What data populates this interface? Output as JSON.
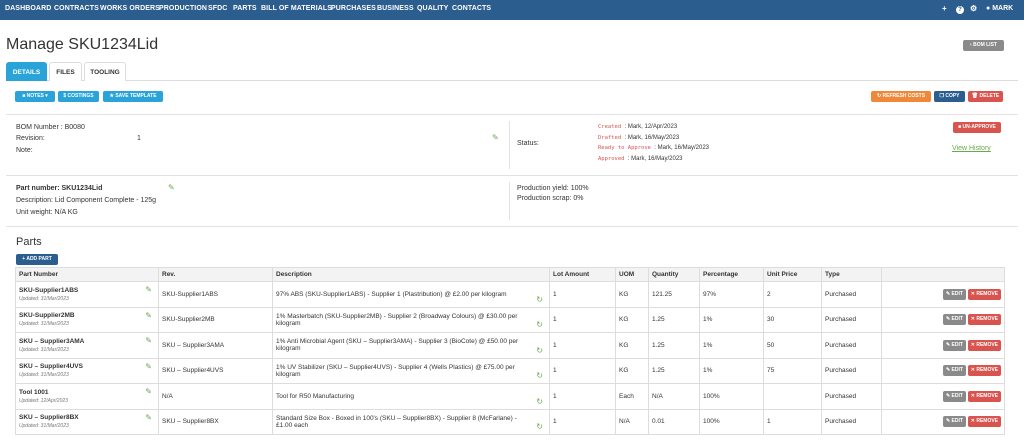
{
  "nav": {
    "items": [
      "DASHBOARD",
      "CONTRACTS",
      "WORKS ORDERS",
      "PRODUCTION",
      "SFDC",
      "PARTS",
      "BILL OF MATERIALS",
      "PURCHASES",
      "BUSINESS",
      "QUALITY",
      "CONTACTS"
    ],
    "plus": "+",
    "help": "?",
    "settings": "⚙",
    "user": "MARK"
  },
  "header": {
    "title": "Manage SKU1234Lid",
    "bom_list": "BOM LIST"
  },
  "tabs": [
    "DETAILS",
    "FILES",
    "TOOLING"
  ],
  "toolbar": {
    "notes": "NOTES",
    "costings": "COSTINGS",
    "save_template": "SAVE TEMPLATE",
    "refresh_costs": "REFRESH COSTS",
    "copy": "COPY",
    "delete": "DELETE"
  },
  "bom": {
    "number": "BOM Number : B0080",
    "revision_label": "Revision:",
    "revision_value": "1",
    "note_label": "Note:",
    "status_label": "Status:",
    "unapprove": "UN-APPROVE",
    "view_history": "View History",
    "history": [
      {
        "label": "Created",
        "value": ": Mark, 12/Apr/2023"
      },
      {
        "label": "Drafted",
        "value": ": Mark, 16/May/2023"
      },
      {
        "label": "Ready to Approve",
        "value": ": Mark, 16/May/2023"
      },
      {
        "label": "Approved",
        "value": ": Mark, 16/May/2023"
      }
    ]
  },
  "part": {
    "number": "Part number: SKU1234Lid",
    "description": "Description: Lid Component Complete - 125g",
    "unit_weight": "Unit weight: N/A KG",
    "yield": "Production yield: 100%",
    "scrap": "Production scrap: 0%"
  },
  "parts": {
    "title": "Parts",
    "add_part": "+ ADD PART",
    "columns": [
      "Part Number",
      "Rev.",
      "Description",
      "Lot Amount",
      "UOM",
      "Quantity",
      "Percentage",
      "Unit Price",
      "Type",
      ""
    ],
    "edit_label": "EDIT",
    "remove_label": "REMOVE",
    "rows": [
      {
        "name": "SKU-Supplier1ABS",
        "updated": "Updated: 31/Mar/2023",
        "rev": "SKU-Supplier1ABS",
        "description": "97% ABS (SKU-Supplier1ABS) - Supplier 1 (Plastribution) @ £2.00 per kilogram",
        "lot": "1",
        "uom": "KG",
        "quantity": "121.25",
        "percentage": "97%",
        "price": "2",
        "type": "Purchased"
      },
      {
        "name": "SKU-Supplier2MB",
        "updated": "Updated: 31/Mar/2023",
        "rev": "SKU-Supplier2MB",
        "description": "1% Masterbatch (SKU-Supplier2MB) - Supplier 2 (Broadway Colours) @ £30.00 per kilogram",
        "lot": "1",
        "uom": "KG",
        "quantity": "1.25",
        "percentage": "1%",
        "price": "30",
        "type": "Purchased"
      },
      {
        "name": "SKU – Supplier3AMA",
        "updated": "Updated: 31/Mar/2023",
        "rev": "SKU – Supplier3AMA",
        "description": "1% Anti Microbial Agent (SKU – Supplier3AMA) - Supplier 3 (BioCote) @ £50.00 per kilogram",
        "lot": "1",
        "uom": "KG",
        "quantity": "1.25",
        "percentage": "1%",
        "price": "50",
        "type": "Purchased"
      },
      {
        "name": "SKU – Supplier4UVS",
        "updated": "Updated: 31/Mar/2023",
        "rev": "SKU – Supplier4UVS",
        "description": "1% UV Stabilizer (SKU – Supplier4UVS) - Supplier 4 (Wells Plastics) @ £75.00 per kilogram",
        "lot": "1",
        "uom": "KG",
        "quantity": "1.25",
        "percentage": "1%",
        "price": "75",
        "type": "Purchased"
      },
      {
        "name": "Tool 1001",
        "updated": "Updated: 12/Apr/2023",
        "rev": "N/A",
        "description": "Tool for R50 Manufacturing",
        "lot": "1",
        "uom": "Each",
        "quantity": "N/A",
        "percentage": "100%",
        "price": "",
        "type": "Purchased"
      },
      {
        "name": "SKU – Supplier8BX",
        "updated": "Updated: 31/Mar/2023",
        "rev": "SKU – Supplier8BX",
        "description": "Standard Size Box - Boxed in 100's (SKU – Supplier8BX) - Supplier 8 (McFarlane) - £1.00 each",
        "lot": "1",
        "uom": "N/A",
        "quantity": "0.01",
        "percentage": "100%",
        "price": "1",
        "type": "Purchased"
      }
    ]
  },
  "colors": {
    "nav_bg": "#2c5d8f",
    "tab_active": "#29a3d8",
    "refresh": "#f0883a",
    "copy": "#2c5d8f",
    "delete": "#d9534f",
    "edit_icon": "#6aa84f"
  }
}
